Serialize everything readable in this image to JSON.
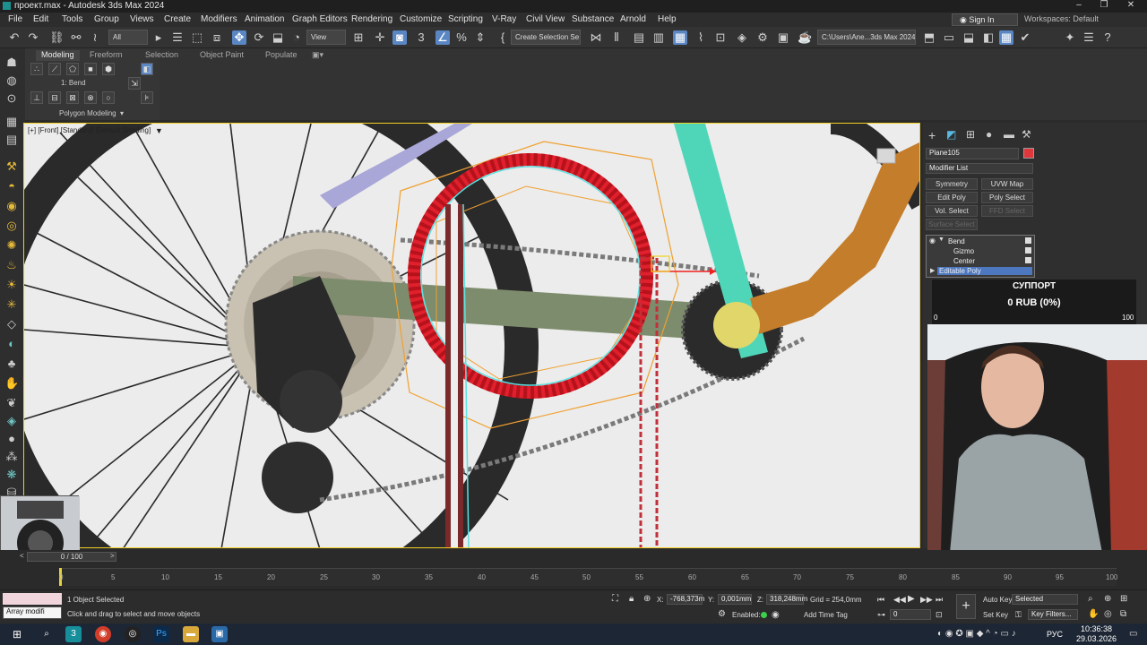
{
  "titlebar": {
    "title": "проект.max - Autodesk 3ds Max 2024"
  },
  "menubar": {
    "items": [
      "File",
      "Edit",
      "Tools",
      "Group",
      "Views",
      "Create",
      "Modifiers",
      "Animation",
      "Graph Editors",
      "Rendering",
      "Customize",
      "Scripting",
      "V-Ray",
      "Civil View",
      "Substance",
      "Arnold",
      "Help"
    ],
    "sign_in": "Sign In",
    "workspaces": "Workspaces: Default"
  },
  "toolbar": {
    "selection_filter": "All",
    "ref_coord": "View",
    "named_selection": "Create Selection Se",
    "path": "C:\\Users\\Ane...3ds Max 2024"
  },
  "ribbon": {
    "tabs": [
      "Modeling",
      "Freeform",
      "Selection",
      "Object Paint",
      "Populate"
    ],
    "modifier_label": "1: Bend",
    "panel_label": "Polygon Modeling"
  },
  "viewport": {
    "label": "[+] [Front] [Standard] [Default Shading]"
  },
  "command_panel": {
    "object_name": "Plane105",
    "object_color": "#e0373d",
    "modifier_list": "Modifier List",
    "buttons": [
      "Symmetry",
      "UVW Map",
      "Edit Poly",
      "Poly Select",
      "Vol. Select",
      "FFD Select",
      "Surface Select"
    ],
    "stack": [
      "Bend",
      "Gizmo",
      "Center",
      "Editable Poly"
    ]
  },
  "donation": {
    "title": "СУППОРТ",
    "amount": "0 RUB (0%)",
    "min": "0",
    "max": "100",
    "progress": 0
  },
  "timeline": {
    "frame_range": "0 / 100",
    "ticks": [
      "0",
      "5",
      "10",
      "15",
      "20",
      "25",
      "30",
      "35",
      "40",
      "45",
      "50",
      "55",
      "60",
      "65",
      "70",
      "75",
      "80",
      "85",
      "90",
      "95",
      "100"
    ]
  },
  "status": {
    "selected": "1 Object Selected",
    "hint": "Click and drag to select and move objects",
    "maxscript": "Array modifi",
    "x_label": "X:",
    "x": "-768,373m",
    "y_label": "Y:",
    "y": "0,001mm",
    "z_label": "Z:",
    "z": "318,248mm",
    "grid": "Grid = 254,0mm",
    "enabled": "Enabled:",
    "add_time_tag": "Add Time Tag",
    "auto_key": "Auto Key",
    "set_key": "Set Key",
    "selected_dd": "Selected",
    "key_filters": "Key Filters...",
    "frame": "0"
  },
  "taskbar": {
    "lang": "РУС",
    "time": "10:36:38",
    "date": "29.03.2026"
  },
  "colors": {
    "accent": "#5a87c4",
    "viewport_border": "#f2d024",
    "wheel_red": "#e0202d"
  }
}
